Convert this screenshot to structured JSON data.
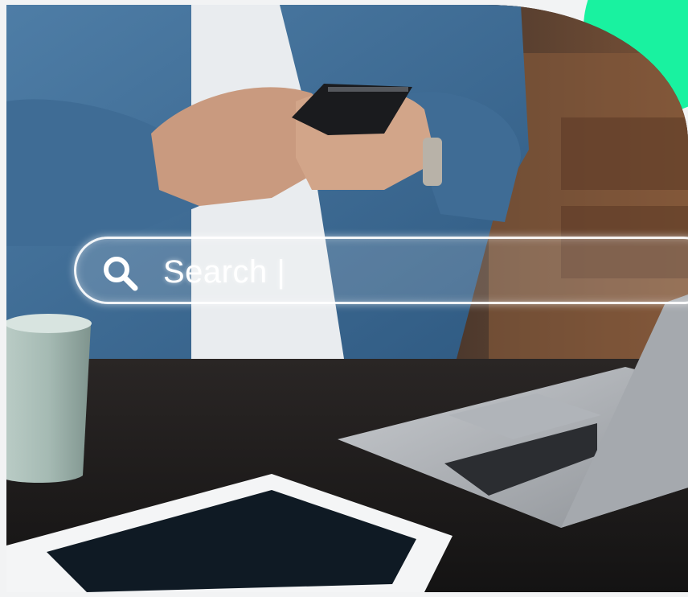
{
  "search": {
    "text": "Search |",
    "icon": "search-icon"
  },
  "colors": {
    "accent": "#19f2a0",
    "frame": "#f2f3f4"
  }
}
